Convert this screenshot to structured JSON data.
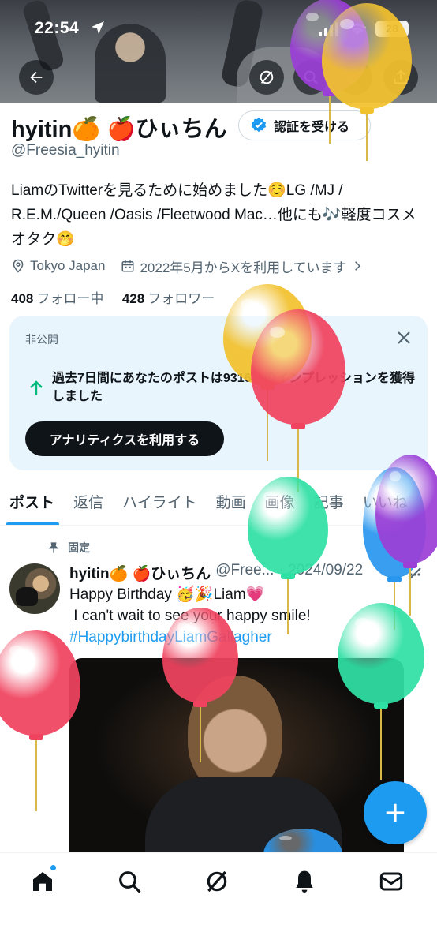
{
  "status_bar": {
    "time": "22:54",
    "battery": "28"
  },
  "profile": {
    "display_name": "hyitin🍊 🍎ひぃちん",
    "verify_button": "認証を受ける",
    "handle": "@Freesia_hyitin",
    "bio": "LiamのTwitterを見るために始めました☺️LG /MJ / R.E.M./Queen /Oasis /Fleetwood Mac…他にも🎶軽度コスメオタク🤭",
    "location": "Tokyo Japan",
    "joined": "2022年5月からXを利用しています",
    "following_count": "408",
    "following_label": "フォロー中",
    "followers_count": "428",
    "followers_label": "フォロワー"
  },
  "private_card": {
    "label": "非公開",
    "message": "過去7日間にあなたのポストは9316件のインプレッションを獲得しました",
    "button": "アナリティクスを利用する"
  },
  "tabs": [
    "ポスト",
    "返信",
    "ハイライト",
    "動画",
    "画像",
    "記事",
    "いいね"
  ],
  "post": {
    "pinned_label": "固定",
    "author_name": "hyitin🍊 🍎ひぃちん",
    "author_handle": "@Free...",
    "date": "· 2024/09/22",
    "line1": "Happy Birthday 🥳🎉Liam💗",
    "line2": " I can't wait to see your happy smile!",
    "hashtag": "#HappybirthdayLiamGallagher"
  },
  "colors": {
    "accent": "#1d9bf0",
    "card_bg": "#e8f5fd",
    "growth": "#00ba7c"
  },
  "icons": {
    "header": [
      "back-arrow-icon",
      "grok-icon",
      "search-icon",
      "edit-icon",
      "share-icon"
    ],
    "bottom_nav": [
      "home-icon",
      "search-icon",
      "grok-icon",
      "notifications-bell-icon",
      "messages-icon"
    ]
  }
}
